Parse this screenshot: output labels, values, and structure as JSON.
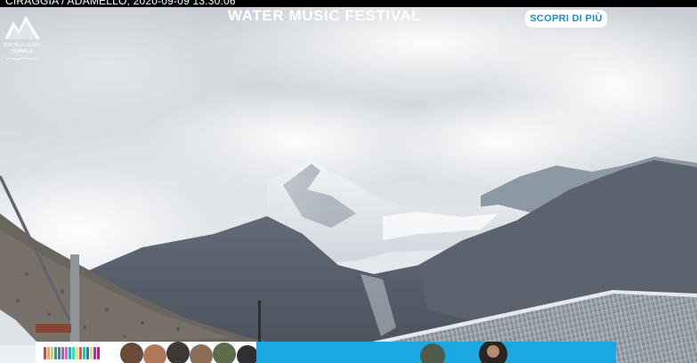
{
  "webcam": {
    "title_overlay": "CIRAGGIA / ADAMELLO, 2020-09-09 13:30:06",
    "logo": {
      "line1": "PONTE DI LEGNO",
      "line2": "TONALE"
    }
  },
  "banner": {
    "headline": "WATER MUSIC FESTIVAL",
    "cta_label": "SCOPRI DI PIÙ",
    "accent_color": "#1ba8e0"
  }
}
